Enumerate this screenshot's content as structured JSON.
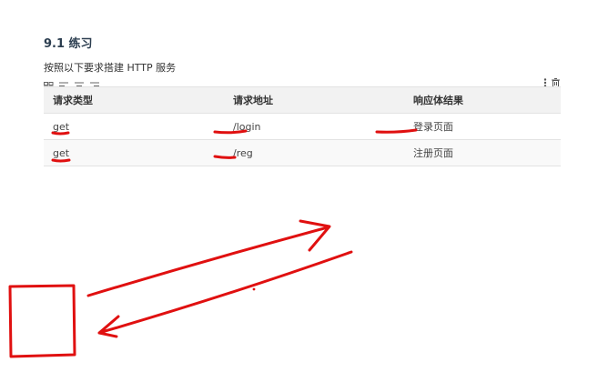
{
  "section": {
    "title": "9.1 练习",
    "description": "按照以下要求搭建 HTTP 服务"
  },
  "toolbar": {
    "left_icons": [
      "table-grid-icon",
      "align-left-icon",
      "align-center-icon",
      "align-right-icon"
    ],
    "right_icons": [
      "more-vertical-icon",
      "trash-icon"
    ]
  },
  "table": {
    "headers": [
      "请求类型",
      "请求地址",
      "响应体结果"
    ],
    "rows": [
      [
        "get",
        "/login",
        "登录页面"
      ],
      [
        "get",
        "/reg",
        "注册页面"
      ]
    ]
  },
  "annotations": {
    "ink_color": "#e01010",
    "shapes": [
      "underline",
      "underline",
      "underline",
      "underline",
      "underline",
      "underline",
      "arrow-right",
      "arrow-left",
      "square",
      "dot"
    ]
  }
}
